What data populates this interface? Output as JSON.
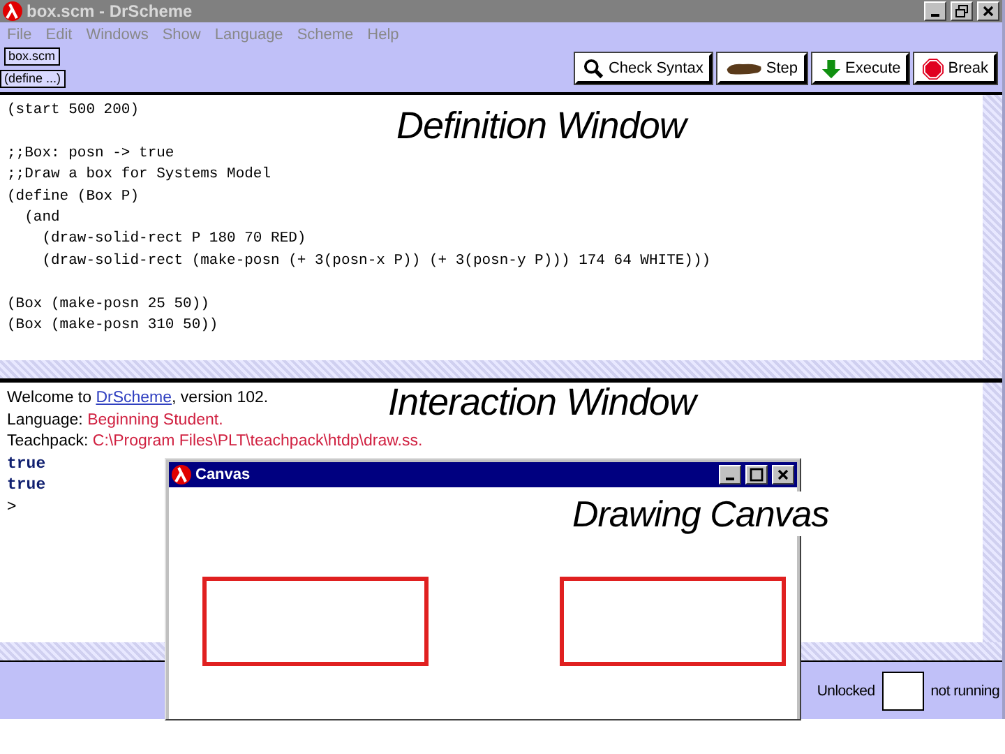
{
  "window": {
    "title": "box.scm - DrScheme"
  },
  "menu": [
    "File",
    "Edit",
    "Windows",
    "Show",
    "Language",
    "Scheme",
    "Help"
  ],
  "file_buttons": [
    "box.scm",
    "(define ...)"
  ],
  "toolbar": [
    {
      "kind": "check",
      "label": "Check Syntax"
    },
    {
      "kind": "step",
      "label": "Step"
    },
    {
      "kind": "execute",
      "label": "Execute"
    },
    {
      "kind": "break",
      "label": "Break"
    }
  ],
  "definitions": {
    "blocks": [
      [
        "(start 500 200)"
      ],
      [
        ";;Box: posn -> true",
        ";;Draw a box for Systems Model",
        "(define (Box P)",
        "  (and",
        "    (draw-solid-rect P 180 70 RED)",
        "    (draw-solid-rect (make-posn (+ 3(posn-x P)) (+ 3(posn-y P))) 174 64 WHITE)))"
      ],
      [
        "(Box (make-posn 25 50))",
        "(Box (make-posn 310 50))"
      ]
    ]
  },
  "interactions": {
    "lines": [
      {
        "kind": "welcome",
        "text": "Welcome to ",
        "link": "DrScheme",
        "rest": ", version 102."
      },
      {
        "kind": "setting",
        "label": "Language:",
        "value": "Beginning Student."
      },
      {
        "kind": "setting",
        "label": "Teachpack:",
        "value": "C:\\Program Files\\PLT\\teachpack\\htdp\\draw.ss."
      },
      {
        "kind": "result",
        "text": "true"
      },
      {
        "kind": "result",
        "text": "true"
      },
      {
        "kind": "prompt",
        "text": ">"
      }
    ]
  },
  "annotations": [
    "Definition Window",
    "Interaction Window",
    "Drawing Canvas"
  ],
  "canvas_window": {
    "title": "Canvas"
  },
  "status_bar": {
    "lock": "Unlocked",
    "run": "not running"
  }
}
